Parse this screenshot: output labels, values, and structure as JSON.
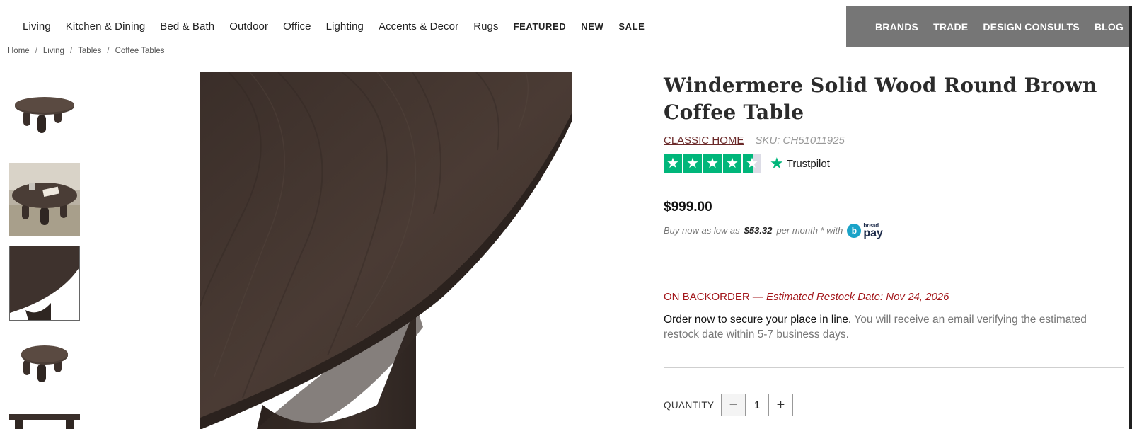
{
  "nav": {
    "left_items": [
      "Living",
      "Kitchen & Dining",
      "Bed & Bath",
      "Outdoor",
      "Office",
      "Lighting",
      "Accents & Decor",
      "Rugs"
    ],
    "featured": "FEATURED",
    "new": "NEW",
    "sale": "SALE",
    "right_items": [
      "BRANDS",
      "TRADE",
      "DESIGN CONSULTS",
      "BLOG"
    ]
  },
  "breadcrumb": [
    "Home",
    "Living",
    "Tables",
    "Coffee Tables"
  ],
  "breadcrumb_sep": "/",
  "product": {
    "title": "Windermere Solid Wood Round Brown Coffee Table",
    "brand": "CLASSIC HOME",
    "sku": "SKU: CH51011925",
    "rating_stars": 4.5,
    "rating_provider": "Trustpilot",
    "price": "$999.00",
    "financing": {
      "prefix": "Buy now as low as",
      "amount": "$53.32",
      "suffix": "per month * with",
      "provider_small": "bread",
      "provider_big": "pay"
    },
    "stock": {
      "status": "ON BACKORDER",
      "restock": "— Estimated Restock Date: Nov 24, 2026"
    },
    "order_note_strong": "Order now to secure your place in line.",
    "order_note_rest": "You will receive an email verifying the estimated restock date within 5-7 business days.",
    "quantity_label": "QUANTITY",
    "quantity_value": "1",
    "qty_minus": "−",
    "qty_plus": "+"
  },
  "colors": {
    "wood_dark": "#3e322d",
    "accent_red": "#a3171b",
    "brand_link": "#6b2a2a",
    "trustpilot_green": "#00b67a",
    "nav_gray": "#767676"
  }
}
